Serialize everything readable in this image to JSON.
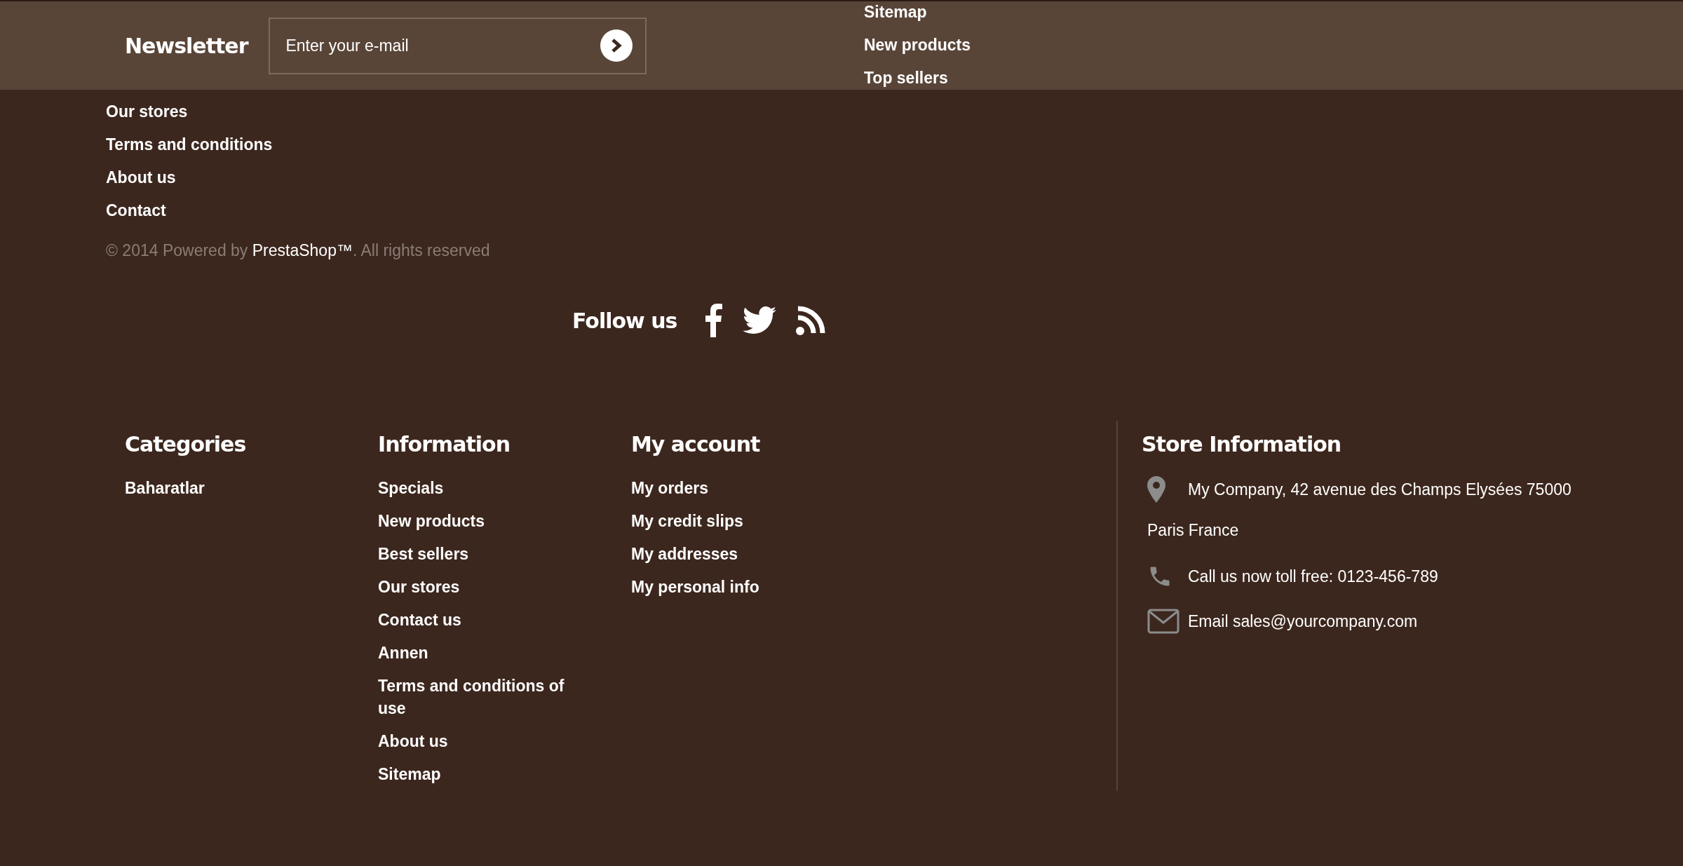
{
  "newsletter": {
    "title": "Newsletter",
    "input": {
      "placeholder": "Enter your e-mail"
    }
  },
  "top_links": [
    "Sitemap",
    "New products",
    "Top sellers"
  ],
  "links": [
    "Our stores",
    "Terms and conditions",
    "About us",
    "Contact"
  ],
  "copyright": {
    "prefix": "© 2014 Powered by ",
    "brand": "PrestaShop™",
    "suffix": ". All rights reserved"
  },
  "follow": {
    "title": "Follow us",
    "networks": [
      {
        "kind": "facebook"
      },
      {
        "kind": "twitter"
      },
      {
        "kind": "rss"
      }
    ]
  },
  "columns": [
    {
      "title": "Categories",
      "items": [
        "Baharatlar"
      ]
    },
    {
      "title": "Information",
      "items": [
        "Specials",
        "New products",
        "Best sellers",
        "Our stores",
        "Contact us",
        "Annen",
        "Terms and conditions of use",
        "About us",
        "Sitemap"
      ]
    },
    {
      "title": "My account",
      "items": [
        "My orders",
        "My credit slips",
        "My addresses",
        "My personal info"
      ]
    }
  ],
  "store": {
    "title": "Store Information",
    "rows": [
      {
        "kind": "location",
        "lines": [
          "My Company, 42 avenue des Champs Elysées 75000",
          "Paris France"
        ]
      },
      {
        "kind": "phone",
        "lines": [
          "Call us now toll free: 0123-456-789"
        ]
      },
      {
        "kind": "email",
        "lines": [
          "Email sales@yourcompany.com"
        ]
      }
    ]
  }
}
